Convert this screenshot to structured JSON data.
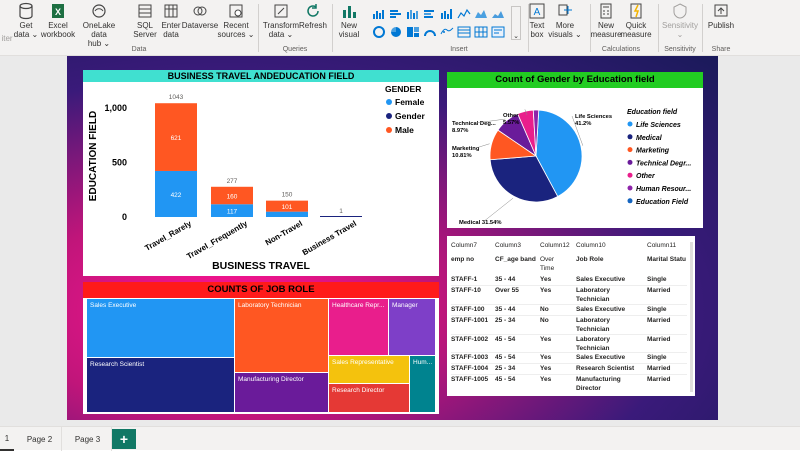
{
  "ribbon": {
    "items": [
      {
        "label": "Get\ndata ⌄",
        "icon": "database-icon"
      },
      {
        "label": "Excel\nworkbook",
        "icon": "excel-icon"
      },
      {
        "label": "OneLake data\nhub ⌄",
        "icon": "onelake-icon"
      },
      {
        "label": "SQL\nServer",
        "icon": "sql-icon"
      },
      {
        "label": "Enter\ndata",
        "icon": "table-icon"
      },
      {
        "label": "Dataverse",
        "icon": "dataverse-icon"
      },
      {
        "label": "Recent\nsources ⌄",
        "icon": "recent-icon"
      },
      {
        "label": "Transform\ndata ⌄",
        "icon": "transform-icon"
      },
      {
        "label": "Refresh",
        "icon": "refresh-icon"
      },
      {
        "label": "New\nvisual",
        "icon": "new-visual-icon"
      },
      {
        "label": "Text\nbox",
        "icon": "textbox-icon"
      },
      {
        "label": "More\nvisuals ⌄",
        "icon": "more-visuals-icon"
      },
      {
        "label": "New\nmeasure",
        "icon": "measure-icon"
      },
      {
        "label": "Quick\nmeasure",
        "icon": "quick-measure-icon"
      },
      {
        "label": "Sensitivity\n⌄",
        "icon": "sensitivity-icon"
      },
      {
        "label": "Publish",
        "icon": "publish-icon"
      }
    ],
    "groups": [
      "Data",
      "Queries",
      "Insert",
      "Calculations",
      "Sensitivity",
      "Share"
    ],
    "left_cut": "iter"
  },
  "bar_chart": {
    "title": "BUSINESS TRAVEL ANDEDUCATION FIELD",
    "title_bg": "#40e0d0",
    "chart_data": {
      "type": "bar",
      "stacked": true,
      "categories": [
        "Travel_Rarely",
        "Travel_Frequently",
        "Non-Travel",
        "Business Travel"
      ],
      "series": [
        {
          "name": "Female",
          "color": "#2196f3",
          "values": [
            422,
            117,
            49,
            0
          ]
        },
        {
          "name": "Gender",
          "color": "#1a237e",
          "values": [
            0,
            0,
            0,
            1
          ]
        },
        {
          "name": "Male",
          "color": "#ff5722",
          "values": [
            621,
            160,
            101,
            0
          ]
        }
      ],
      "totals": [
        "1043",
        "277",
        "150",
        "1"
      ],
      "labels": {
        "Travel_Rarely": [
          "422",
          "621"
        ],
        "Travel_Frequently": [
          "117",
          "160"
        ],
        "Non-Travel": [
          "",
          "101"
        ]
      },
      "xlabel": "BUSINESS TRAVEL",
      "ylabel": "EDUCATION FIELD",
      "ytick_labels": [
        "0",
        "500",
        "1,000"
      ],
      "ylim": [
        0,
        1100
      ],
      "legend_title": "GENDER"
    }
  },
  "pie_chart": {
    "title": "Count of Gender by Education field",
    "title_bg": "#22cc22",
    "chart_data": {
      "type": "pie",
      "slices": [
        {
          "name": "Life Sciences",
          "value": 41.2,
          "color": "#2196f3",
          "label": "Life Sciences\n41.2%"
        },
        {
          "name": "Medical",
          "value": 31.54,
          "color": "#1a237e",
          "label": "Medical 31.54%"
        },
        {
          "name": "Marketing",
          "value": 10.81,
          "color": "#ff5722",
          "label": "Marketing\n10.81%"
        },
        {
          "name": "Technical Degree",
          "value": 8.97,
          "color": "#6a1b9a",
          "label": "Technical Deg...\n8.97%"
        },
        {
          "name": "Other",
          "value": 5.57,
          "color": "#e91e8c",
          "label": "Other\n5.57%"
        },
        {
          "name": "Human Resources",
          "value": 1.9,
          "color": "#8e24aa",
          "label": ""
        }
      ],
      "legend_title": "Education field",
      "legend": [
        "Life Sciences",
        "Medical",
        "Marketing",
        "Technical Degr...",
        "Other",
        "Human Resour...",
        "Education Field"
      ],
      "legend_colors": [
        "#2196f3",
        "#1a237e",
        "#ff5722",
        "#6a1b9a",
        "#e91e8c",
        "#8e24aa",
        "#1565c0"
      ]
    }
  },
  "treemap": {
    "title": "COUNTS OF JOB ROLE",
    "title_bg": "#ff1a1a",
    "tiles": [
      {
        "name": "Sales Executive",
        "color": "#2196f3"
      },
      {
        "name": "Research Scientist",
        "color": "#1a237e"
      },
      {
        "name": "Laboratory Technician",
        "color": "#ff5722"
      },
      {
        "name": "Manufacturing Director",
        "color": "#6a1b9a"
      },
      {
        "name": "Healthcare Repr...",
        "color": "#e91e8c"
      },
      {
        "name": "Manager",
        "color": "#7e3fc8"
      },
      {
        "name": "Sales Representative",
        "color": "#f4c20d"
      },
      {
        "name": "Research Director",
        "color": "#e53935"
      },
      {
        "name": "Hum...",
        "color": "#00838f"
      }
    ]
  },
  "table": {
    "headers_top": [
      "Column7",
      "Column3",
      "Column12",
      "Column10",
      "Column11"
    ],
    "headers": [
      "emp no",
      "CF_age band",
      "Over\nTime",
      "Job Role",
      "Marital Statu"
    ],
    "rows": [
      [
        "STAFF-1",
        "35 - 44",
        "Yes",
        "Sales Executive",
        "Single"
      ],
      [
        "STAFF-10",
        "Over 55",
        "Yes",
        "Laboratory\nTechnician",
        "Married"
      ],
      [
        "STAFF-100",
        "35 - 44",
        "No",
        "Sales Executive",
        "Single"
      ],
      [
        "STAFF-1001",
        "25 - 34",
        "No",
        "Laboratory\nTechnician",
        "Married"
      ],
      [
        "STAFF-1002",
        "45 - 54",
        "Yes",
        "Laboratory\nTechnician",
        "Married"
      ],
      [
        "STAFF-1003",
        "45 - 54",
        "Yes",
        "Sales Executive",
        "Single"
      ],
      [
        "STAFF-1004",
        "25 - 34",
        "Yes",
        "Research Scientist",
        "Married"
      ],
      [
        "STAFF-1005",
        "45 - 54",
        "Yes",
        "Manufacturing\nDirector",
        "Married"
      ]
    ]
  },
  "tabs": {
    "items": [
      "1",
      "Page 2",
      "Page 3"
    ],
    "add_label": "+"
  }
}
